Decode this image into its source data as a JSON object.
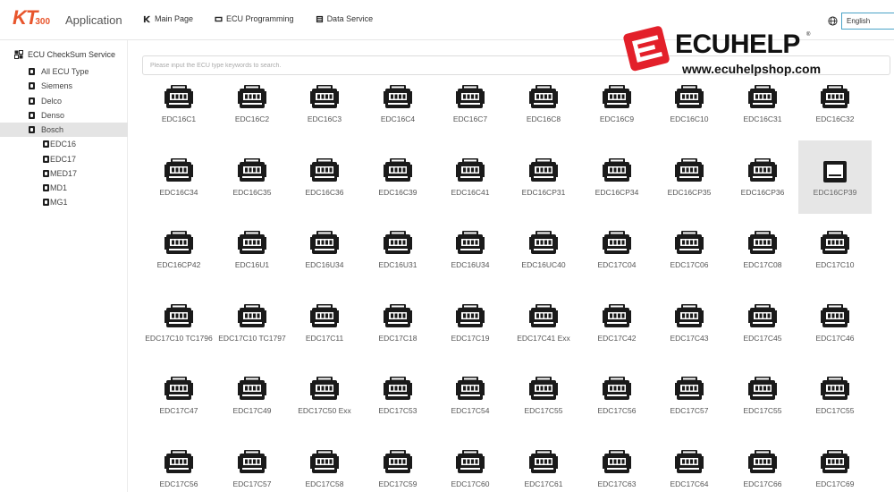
{
  "app": {
    "brand_main": "KT",
    "brand_sub": "300",
    "title": "Application"
  },
  "nav": [
    {
      "label": "Main Page",
      "icon": "k-logo-icon"
    },
    {
      "label": "ECU Programming",
      "icon": "chip-icon"
    },
    {
      "label": "Data Service",
      "icon": "list-icon"
    }
  ],
  "language": {
    "icon": "globe-icon",
    "selected": "English"
  },
  "sidebar": {
    "title": "ECU CheckSum Service",
    "items": [
      {
        "label": "All ECU Type",
        "level": 1,
        "active": false
      },
      {
        "label": "Siemens",
        "level": 1,
        "active": false
      },
      {
        "label": "Delco",
        "level": 1,
        "active": false
      },
      {
        "label": "Denso",
        "level": 1,
        "active": false
      },
      {
        "label": "Bosch",
        "level": 1,
        "active": true
      },
      {
        "label": "EDC16",
        "level": 2,
        "active": false
      },
      {
        "label": "EDC17",
        "level": 2,
        "active": false
      },
      {
        "label": "MED17",
        "level": 2,
        "active": false
      },
      {
        "label": "MD1",
        "level": 2,
        "active": false
      },
      {
        "label": "MG1",
        "level": 2,
        "active": false
      }
    ]
  },
  "search": {
    "placeholder": "Please input the ECU type keywords to search.",
    "value": ""
  },
  "grid": {
    "items": [
      "EDC16C1",
      "EDC16C2",
      "EDC16C3",
      "EDC16C4",
      "EDC16C7",
      "EDC16C8",
      "EDC16C9",
      "EDC16C10",
      "EDC16C31",
      "EDC16C32",
      "EDC16C34",
      "EDC16C35",
      "EDC16C36",
      "EDC16C39",
      "EDC16C41",
      "EDC16CP31",
      "EDC16CP34",
      "EDC16CP35",
      "EDC16CP36",
      "EDC16CP39",
      "EDC16CP42",
      "EDC16U1",
      "EDC16U34",
      "EDC16U31",
      "EDC16U34",
      "EDC16UC40",
      "EDC17C04",
      "EDC17C06",
      "EDC17C08",
      "EDC17C10",
      "EDC17C10 TC1796",
      "EDC17C10 TC1797",
      "EDC17C11",
      "EDC17C18",
      "EDC17C19",
      "EDC17C41 Exx",
      "EDC17C42",
      "EDC17C43",
      "EDC17C45",
      "EDC17C46",
      "EDC17C47",
      "EDC17C49",
      "EDC17C50 Exx",
      "EDC17C53",
      "EDC17C54",
      "EDC17C55",
      "EDC17C56",
      "EDC17C57",
      "EDC17C55",
      "EDC17C55",
      "EDC17C56",
      "EDC17C57",
      "EDC17C58",
      "EDC17C59",
      "EDC17C60",
      "EDC17C61",
      "EDC17C63",
      "EDC17C64",
      "EDC17C66",
      "EDC17C69"
    ],
    "selected_index": 19,
    "icon": "ecu-module-icon"
  },
  "watermark": {
    "brand": "ECUHELP",
    "url": "www.ecuhelpshop.com",
    "reg": "®"
  },
  "colors": {
    "brand": "#e8552c",
    "watermark_red": "#e3202a",
    "selected_bg": "#e6e6e6",
    "lang_border": "#4aa3c7"
  }
}
